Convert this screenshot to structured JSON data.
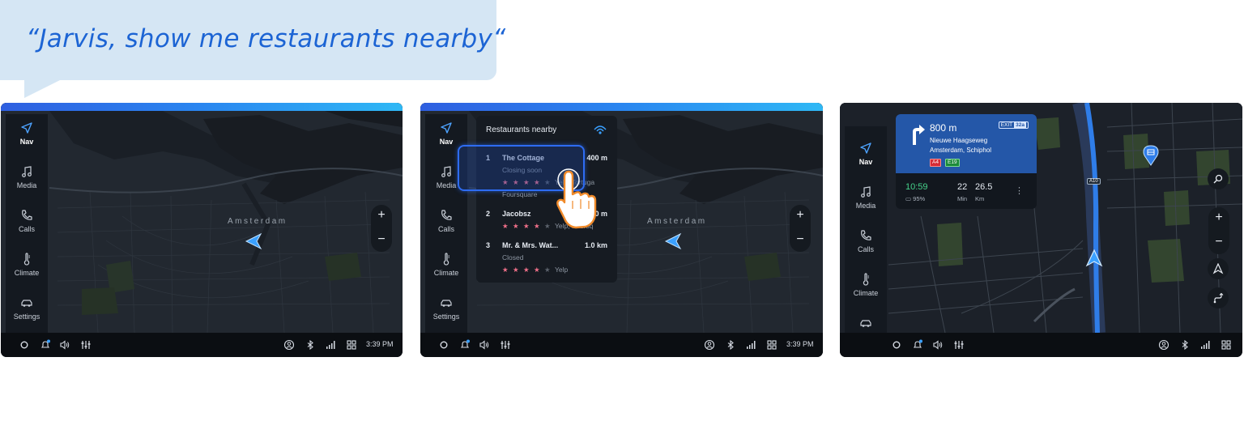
{
  "speech": {
    "text": "“Jarvis, show me restaurants nearby“"
  },
  "sidebar": {
    "items": [
      {
        "label": "Nav",
        "icon": "navigation-arrow-icon"
      },
      {
        "label": "Media",
        "icon": "music-note-icon"
      },
      {
        "label": "Calls",
        "icon": "phone-icon"
      },
      {
        "label": "Climate",
        "icon": "thermometer-icon"
      },
      {
        "label": "Settings",
        "icon": "car-icon"
      }
    ]
  },
  "map": {
    "city_label": "Amsterdam",
    "zoom_in": "+",
    "zoom_out": "−"
  },
  "statusbar": {
    "time": "3:39 PM"
  },
  "restaurants": {
    "title": "Restaurants nearby",
    "items": [
      {
        "index": "1",
        "name": "The Cottage",
        "distance": "400 m",
        "status": "Closing soon",
        "rating": 4,
        "sources": "Yelp, Tortuga",
        "extra_source": "Foursquare"
      },
      {
        "index": "2",
        "name": "Jacobsz",
        "distance": "650 m",
        "status": "",
        "rating": 4,
        "sources": "Yelp, Foursq"
      },
      {
        "index": "3",
        "name": "Mr. & Mrs. Wat...",
        "distance": "1.0 km",
        "status": "Closed",
        "rating": 4,
        "sources": "Yelp"
      }
    ],
    "stars_on": "★ ★ ★ ★",
    "stars_off": "★"
  },
  "navigation": {
    "distance": "800 m",
    "exit_label": "EXIT",
    "exit_number": "32a",
    "street": "Nieuwe Haagseweg",
    "direction": "Amsterdam, Schiphol",
    "road_badges": [
      "A4",
      "E19"
    ],
    "eta": "10:59",
    "battery": "95%",
    "minutes": "22",
    "minutes_label": "Min",
    "km": "26.5",
    "km_label": "Km",
    "more": "⋮",
    "highway_label": "A10"
  },
  "colors": {
    "accent": "#2e6cf2",
    "speech_bg": "#d5e6f4",
    "speech_text": "#1c64d4",
    "eta_green": "#46d38b",
    "star_pink": "#f07089"
  }
}
